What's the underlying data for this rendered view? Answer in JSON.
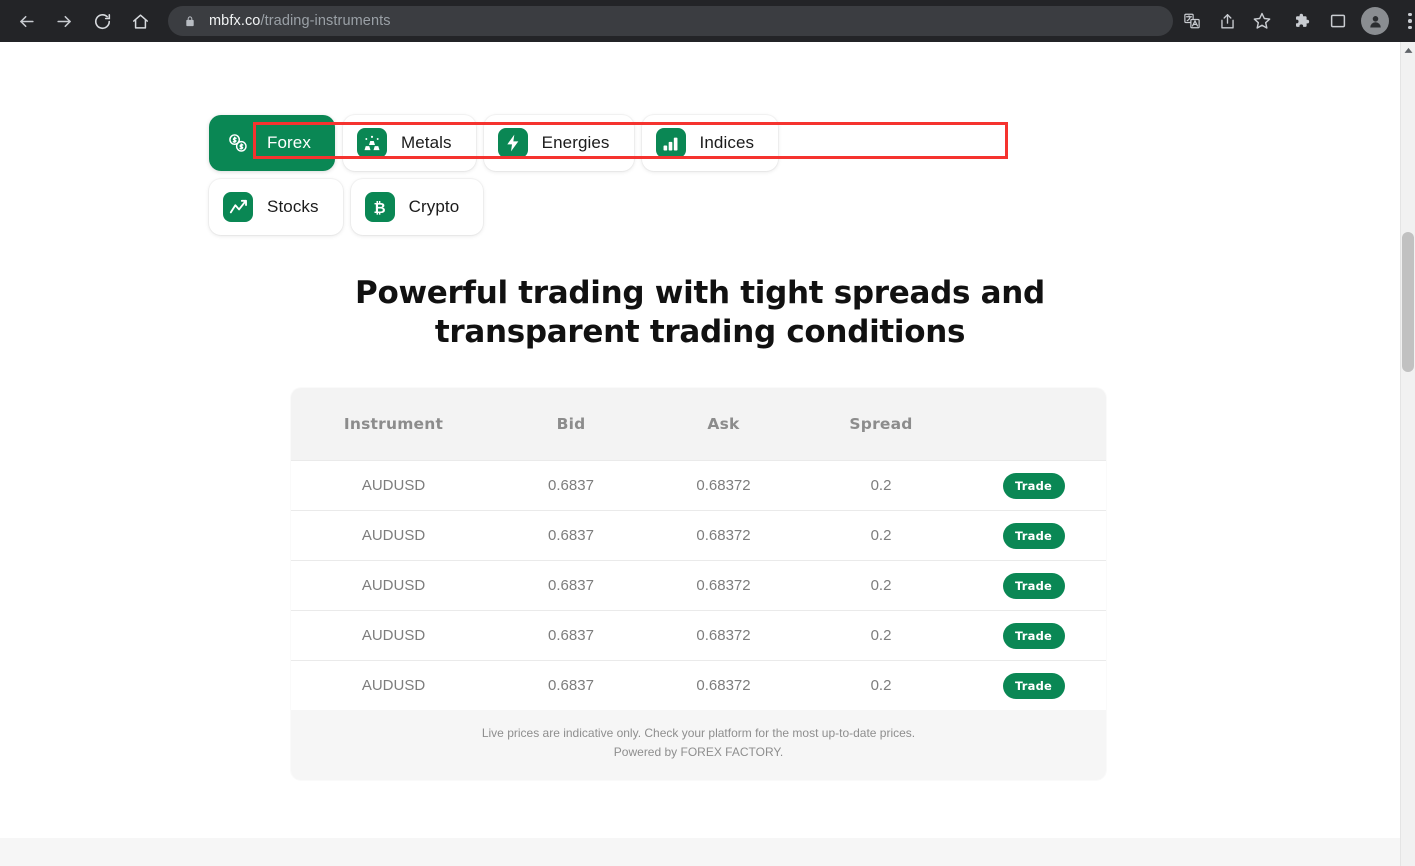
{
  "browser": {
    "back_icon": "back-arrow-icon",
    "forward_icon": "forward-arrow-icon",
    "reload_icon": "reload-icon",
    "home_icon": "home-icon",
    "lock_icon": "lock-icon",
    "url_host": "mbfx.co",
    "url_path": "/trading-instruments",
    "translate_icon": "translate-icon",
    "share_icon": "share-icon",
    "bookmark_icon": "bookmark-star-icon",
    "extensions_icon": "extensions-puzzle-icon",
    "sidepanel_icon": "side-panel-icon",
    "profile_icon": "profile-avatar-icon",
    "menu_icon": "three-dot-menu-icon"
  },
  "tabs": [
    {
      "label": "Forex",
      "icon": "currency-exchange-icon",
      "active": true
    },
    {
      "label": "Metals",
      "icon": "gold-bars-icon",
      "active": false
    },
    {
      "label": "Energies",
      "icon": "lightning-bolt-icon",
      "active": false
    },
    {
      "label": "Indices",
      "icon": "bar-chart-icon",
      "active": false
    },
    {
      "label": "Stocks",
      "icon": "line-chart-icon",
      "active": false
    },
    {
      "label": "Crypto",
      "icon": "bitcoin-icon",
      "active": false
    }
  ],
  "heading": {
    "line1": "Powerful trading with tight spreads and",
    "line2": "transparent trading conditions"
  },
  "table": {
    "columns": [
      "Instrument",
      "Bid",
      "Ask",
      "Spread"
    ],
    "action_label": "Trade",
    "rows": [
      {
        "instrument": "AUDUSD",
        "bid": "0.6837",
        "ask": "0.68372",
        "spread": "0.2",
        "action": "Trade"
      },
      {
        "instrument": "AUDUSD",
        "bid": "0.6837",
        "ask": "0.68372",
        "spread": "0.2",
        "action": "Trade"
      },
      {
        "instrument": "AUDUSD",
        "bid": "0.6837",
        "ask": "0.68372",
        "spread": "0.2",
        "action": "Trade"
      },
      {
        "instrument": "AUDUSD",
        "bid": "0.6837",
        "ask": "0.68372",
        "spread": "0.2",
        "action": "Trade"
      },
      {
        "instrument": "AUDUSD",
        "bid": "0.6837",
        "ask": "0.68372",
        "spread": "0.2",
        "action": "Trade"
      }
    ],
    "footer_line1": "Live prices are indicative only. Check your platform for the most up-to-date prices.",
    "footer_line2": "Powered by FOREX FACTORY."
  },
  "colors": {
    "brand_green": "#0a8754",
    "annotation_red": "#f5332f",
    "chrome_dark": "#232427",
    "omnibox": "#3b3d41"
  }
}
